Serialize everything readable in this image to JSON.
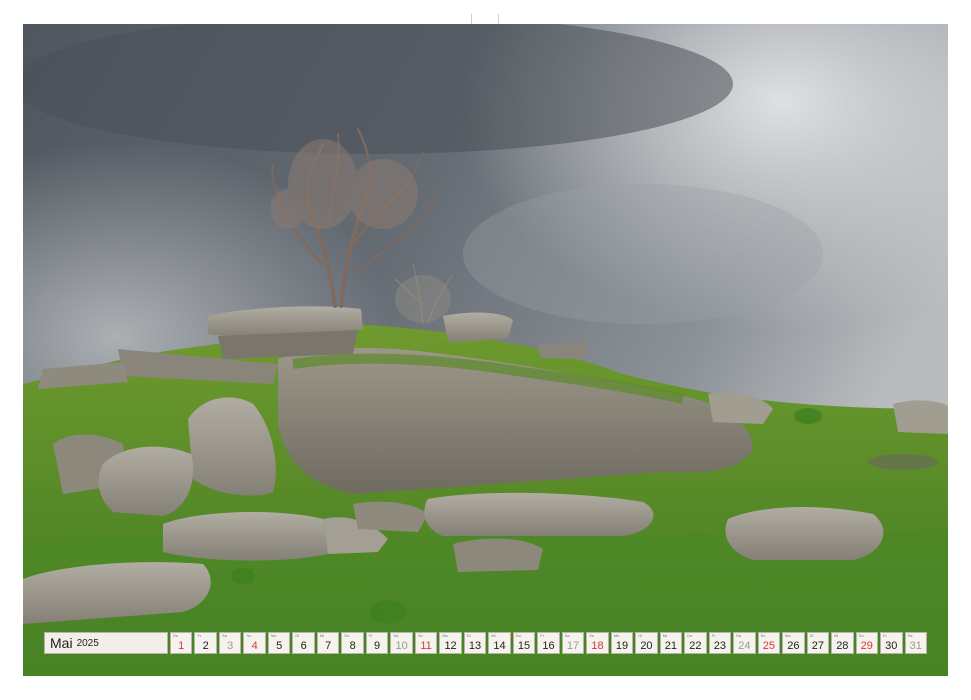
{
  "calendar": {
    "month": "Mai",
    "year": "2025",
    "days": [
      {
        "wd": "Do",
        "d": "1",
        "type": "hol"
      },
      {
        "wd": "Fr",
        "d": "2",
        "type": "work"
      },
      {
        "wd": "Sa",
        "d": "3",
        "type": "sat"
      },
      {
        "wd": "So",
        "d": "4",
        "type": "sun"
      },
      {
        "wd": "Mo",
        "d": "5",
        "type": "work"
      },
      {
        "wd": "Di",
        "d": "6",
        "type": "work"
      },
      {
        "wd": "Mi",
        "d": "7",
        "type": "work"
      },
      {
        "wd": "Do",
        "d": "8",
        "type": "work"
      },
      {
        "wd": "Fr",
        "d": "9",
        "type": "work"
      },
      {
        "wd": "Sa",
        "d": "10",
        "type": "sat"
      },
      {
        "wd": "So",
        "d": "11",
        "type": "sun"
      },
      {
        "wd": "Mo",
        "d": "12",
        "type": "work"
      },
      {
        "wd": "Di",
        "d": "13",
        "type": "work"
      },
      {
        "wd": "Mi",
        "d": "14",
        "type": "work"
      },
      {
        "wd": "Do",
        "d": "15",
        "type": "work"
      },
      {
        "wd": "Fr",
        "d": "16",
        "type": "work"
      },
      {
        "wd": "Sa",
        "d": "17",
        "type": "sat"
      },
      {
        "wd": "So",
        "d": "18",
        "type": "sun"
      },
      {
        "wd": "Mo",
        "d": "19",
        "type": "work"
      },
      {
        "wd": "Di",
        "d": "20",
        "type": "work"
      },
      {
        "wd": "Mi",
        "d": "21",
        "type": "work"
      },
      {
        "wd": "Do",
        "d": "22",
        "type": "work"
      },
      {
        "wd": "Fr",
        "d": "23",
        "type": "work"
      },
      {
        "wd": "Sa",
        "d": "24",
        "type": "sat"
      },
      {
        "wd": "So",
        "d": "25",
        "type": "sun"
      },
      {
        "wd": "Mo",
        "d": "26",
        "type": "work"
      },
      {
        "wd": "Di",
        "d": "27",
        "type": "work"
      },
      {
        "wd": "Mi",
        "d": "28",
        "type": "work"
      },
      {
        "wd": "Do",
        "d": "29",
        "type": "hol"
      },
      {
        "wd": "Fr",
        "d": "30",
        "type": "work"
      },
      {
        "wd": "Sa",
        "d": "31",
        "type": "sat"
      }
    ]
  },
  "colors": {
    "sunday": "#d23b3b",
    "saturday": "#9a9a9a",
    "cell": "#f6f2ee"
  }
}
